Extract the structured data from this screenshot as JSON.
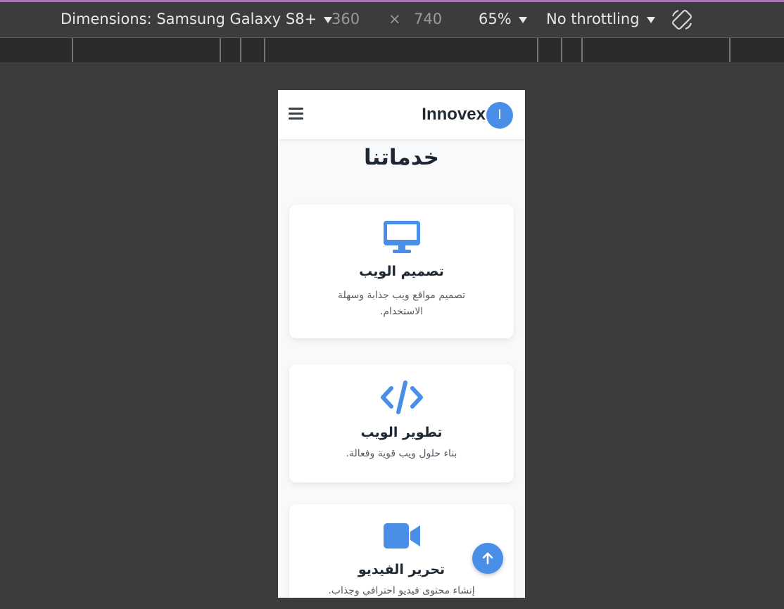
{
  "devtools": {
    "dimensions_label": "Dimensions: Samsung Galaxy S8+",
    "width_value": "360",
    "times_symbol": "×",
    "height_value": "740",
    "zoom_label": "65%",
    "throttling_label": "No throttling",
    "rotate_icon": "rotate-device-icon"
  },
  "site": {
    "brand": "Innovex",
    "logo_letter": "I",
    "menu_icon": "hamburger-menu-icon",
    "accent_color": "#4a8fe7",
    "title": "خدماتنا"
  },
  "services": [
    {
      "icon": "desktop-monitor-icon",
      "title": "تصميم الويب",
      "description": "تصميم مواقع ويب جذابة وسهلة الاستخدام."
    },
    {
      "icon": "code-icon",
      "title": "تطوير الويب",
      "description": "بناء حلول ويب قوية وفعالة."
    },
    {
      "icon": "video-camera-icon",
      "title": "تحرير الفيديو",
      "description": "إنشاء محتوى فيديو احترافي وجذاب."
    }
  ],
  "scroll_top_icon": "arrow-up-icon"
}
